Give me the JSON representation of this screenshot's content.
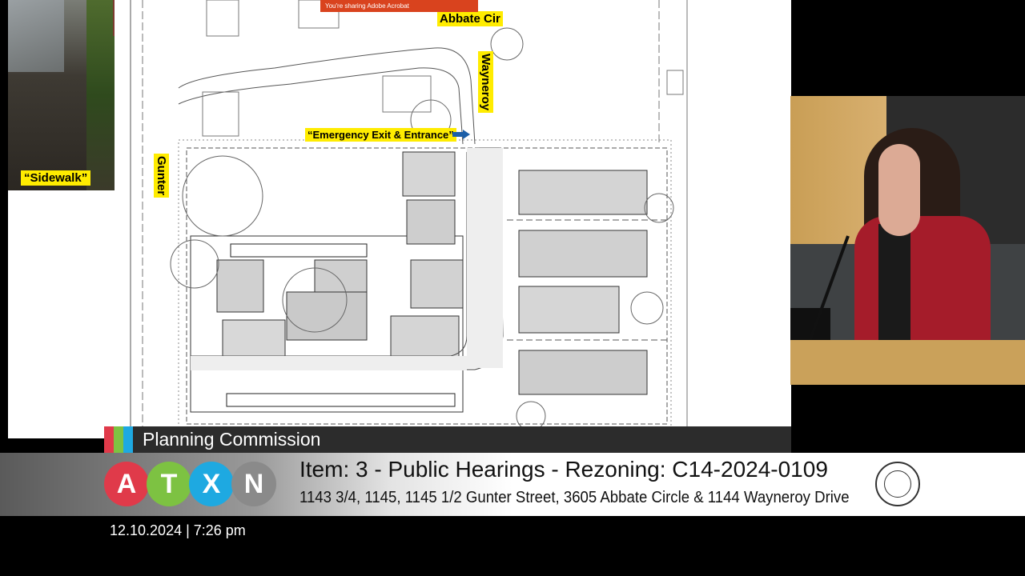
{
  "photo": {
    "label": "“Sidewalk”"
  },
  "plan_labels": {
    "abbate": "Abbate Cir",
    "gunter": "Gunter",
    "wayneroy": "Wayneroy",
    "emergency": "“Emergency Exit & Entrance”"
  },
  "share_bar": {
    "text": "You're sharing Adobe Acrobat"
  },
  "lower_third": {
    "title": "Planning Commission",
    "logo_letters": [
      "A",
      "T",
      "X",
      "N"
    ],
    "item_title": "Item: 3 - Public Hearings - Rezoning: C14-2024-0109",
    "item_address": "1143 3/4, 1145, 1145 1/2 Gunter Street, 3605 Abbate Circle & 1144 Wayneroy Drive"
  },
  "timestamp": "12.10.2024 | 7:26 pm",
  "colors": {
    "highlight": "#ffec00",
    "logo_a": "#e03a4a",
    "logo_t": "#7dc242",
    "logo_x": "#1ea9e1",
    "logo_n": "#8a8a8a",
    "stripes": [
      "#e03a4a",
      "#7dc242",
      "#1ea9e1"
    ]
  }
}
